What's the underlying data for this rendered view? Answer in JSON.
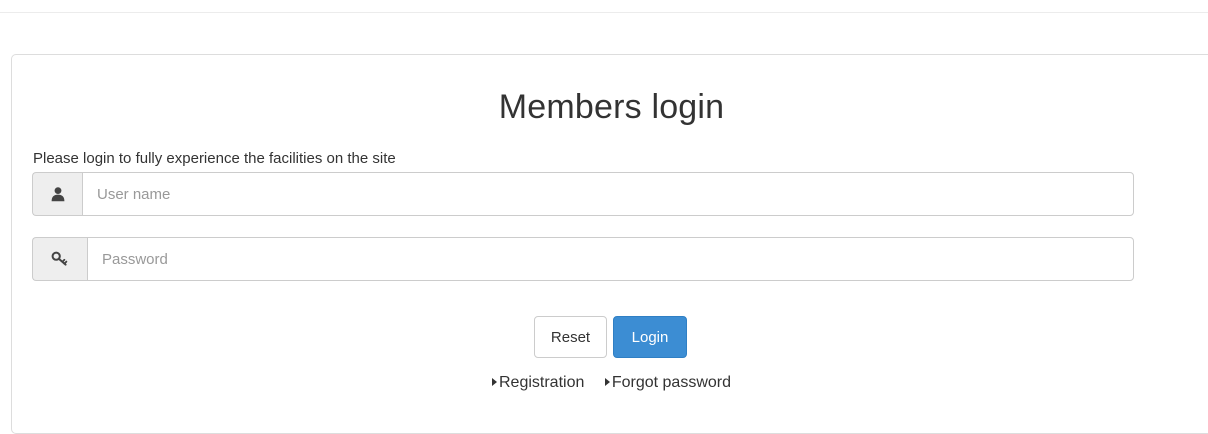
{
  "header": {
    "title": "Members login",
    "subtitle": "Please login to fully experience the facilities on the site"
  },
  "form": {
    "username": {
      "placeholder": "User name",
      "value": "",
      "icon": "user-icon"
    },
    "password": {
      "placeholder": "Password",
      "value": "",
      "icon": "key-icon"
    }
  },
  "buttons": {
    "reset": "Reset",
    "login": "Login"
  },
  "links": {
    "registration": "Registration",
    "forgot": "Forgot password"
  },
  "colors": {
    "primary": "#3c8dd3",
    "addon_bg": "#eeeeee",
    "border": "#cccccc"
  }
}
